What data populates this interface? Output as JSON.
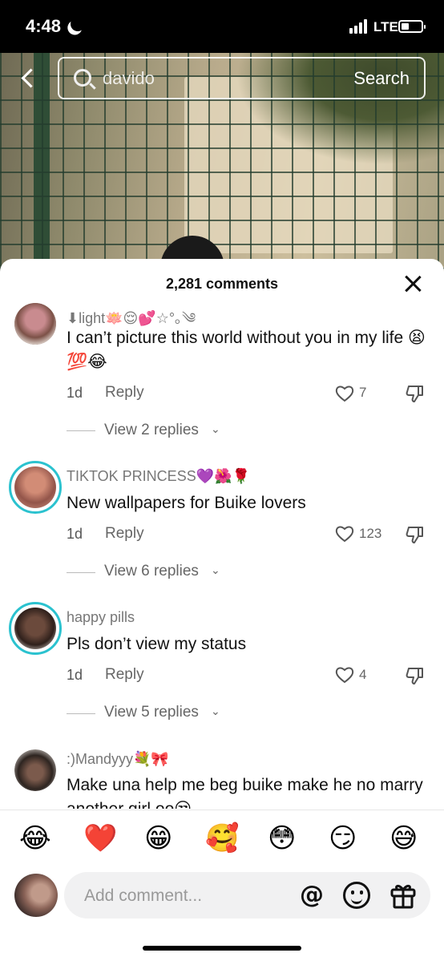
{
  "status_bar": {
    "time": "4:48",
    "network": "LTE"
  },
  "search": {
    "value": "davido",
    "button": "Search"
  },
  "comments_header": {
    "count_label": "2,281 comments"
  },
  "comments": [
    {
      "username": "⬇light🪷😌💕☆°｡༄",
      "text": "I can’t picture this world without you in my life 😫💯😂",
      "date": "1d",
      "reply": "Reply",
      "likes": "7",
      "view_replies": "View 2 replies",
      "avatar_color": "#8d6a60"
    },
    {
      "username": "TIKTOK PRINCESS💜🌺🌹",
      "text": "New wallpapers for Buike lovers",
      "date": "1d",
      "reply": "Reply",
      "likes": "123",
      "view_replies": "View 6 replies",
      "avatar_color": "#b87a6b"
    },
    {
      "username": "happy pills",
      "text": "Pls don’t view my status",
      "date": "1d",
      "reply": "Reply",
      "likes": "4",
      "view_replies": "View 5 replies",
      "avatar_color": "#3b2a24"
    },
    {
      "username": ":)Mandyyy💐🎀",
      "text": "Make una help me beg buike make he no marry another girl oo😒",
      "avatar_color": "#2d2420"
    }
  ],
  "emoji_bar": [
    "😂",
    "❤️",
    "😁",
    "🥰",
    "😳",
    "😏",
    "😅"
  ],
  "input": {
    "placeholder": "Add comment...",
    "at_symbol": "@"
  },
  "colors": {
    "ring": "#2bc2cf",
    "panel": "#ffffff",
    "status_bar": "#000000"
  },
  "icons": [
    "back-icon",
    "search-icon",
    "close-icon",
    "heart-icon",
    "dislike-icon",
    "chevron-down-icon",
    "at-icon",
    "smile-icon",
    "gift-icon"
  ]
}
